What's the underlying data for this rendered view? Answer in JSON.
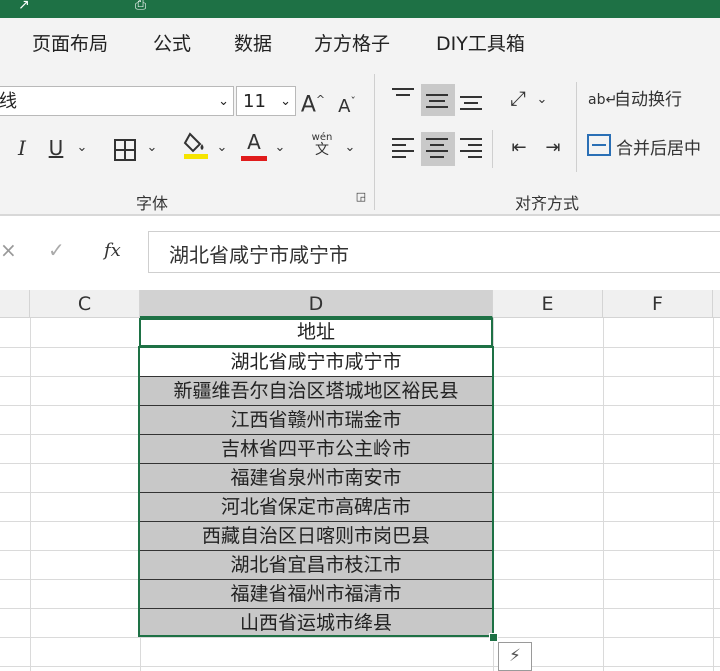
{
  "menu": {
    "tabs": [
      "页面布局",
      "公式",
      "数据",
      "方方格子",
      "DIY工具箱"
    ]
  },
  "ribbon": {
    "font_name": "线",
    "font_size": "11",
    "grow_font_label": "A",
    "shrink_font_label": "A",
    "italic_label": "I",
    "underline_label": "U",
    "font_color_label": "A",
    "phonetic_top": "wén",
    "phonetic_bottom": "文",
    "wrap_text_label": "自动换行",
    "merge_center_label": "合并后居中",
    "font_group_label": "字体",
    "align_group_label": "对齐方式"
  },
  "formula_bar": {
    "fx_label": "fx",
    "content": "湖北省咸宁市咸宁市"
  },
  "columns": [
    "C",
    "D",
    "E",
    "F"
  ],
  "active_column": "D",
  "table": {
    "header": "地址",
    "rows": [
      "湖北省咸宁市咸宁市",
      "新疆维吾尔自治区塔城地区裕民县",
      "江西省赣州市瑞金市",
      "吉林省四平市公主岭市",
      "福建省泉州市南安市",
      "河北省保定市高碑店市",
      "西藏自治区日喀则市岗巴县",
      "湖北省宜昌市枝江市",
      "福建省福州市福清市",
      "山西省运城市绛县"
    ]
  },
  "colors": {
    "accent": "#1e7145",
    "selection_fill": "#c8c8c8",
    "font_color_bar": "#e01b1b",
    "highlight_bar": "#f5e400"
  }
}
